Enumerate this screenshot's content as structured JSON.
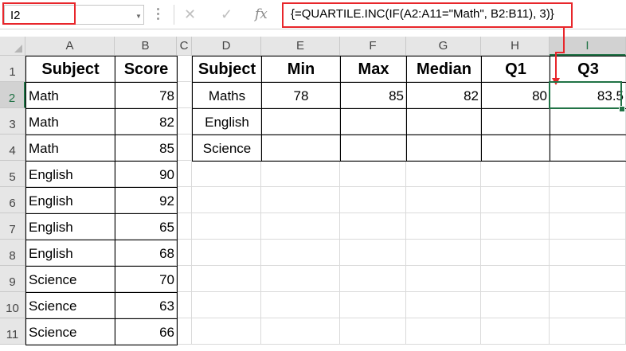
{
  "formula_bar": {
    "name_box": "I2",
    "formula": "{=QUARTILE.INC(IF(A2:A11=\"Math\", B2:B11), 3)}",
    "cancel_icon": "✕",
    "enter_icon": "✓",
    "fx_label": "fx"
  },
  "columns": [
    "A",
    "B",
    "C",
    "D",
    "E",
    "F",
    "G",
    "H",
    "I"
  ],
  "rows": [
    "1",
    "2",
    "3",
    "4",
    "5",
    "6",
    "7",
    "8",
    "9",
    "10",
    "11"
  ],
  "source_table": {
    "headers": [
      "Subject",
      "Score"
    ],
    "rows": [
      [
        "Math",
        "78"
      ],
      [
        "Math",
        "82"
      ],
      [
        "Math",
        "85"
      ],
      [
        "English",
        "90"
      ],
      [
        "English",
        "92"
      ],
      [
        "English",
        "65"
      ],
      [
        "English",
        "68"
      ],
      [
        "Science",
        "70"
      ],
      [
        "Science",
        "63"
      ],
      [
        "Science",
        "66"
      ]
    ]
  },
  "stats_table": {
    "headers": [
      "Subject",
      "Min",
      "Max",
      "Median",
      "Q1",
      "Q3"
    ],
    "rows": [
      [
        "Maths",
        "78",
        "85",
        "82",
        "80",
        "83.5"
      ],
      [
        "English",
        "",
        "",
        "",
        "",
        ""
      ],
      [
        "Science",
        "",
        "",
        "",
        "",
        ""
      ]
    ]
  },
  "colors": {
    "highlight": "#e8262b",
    "selection": "#217346"
  }
}
